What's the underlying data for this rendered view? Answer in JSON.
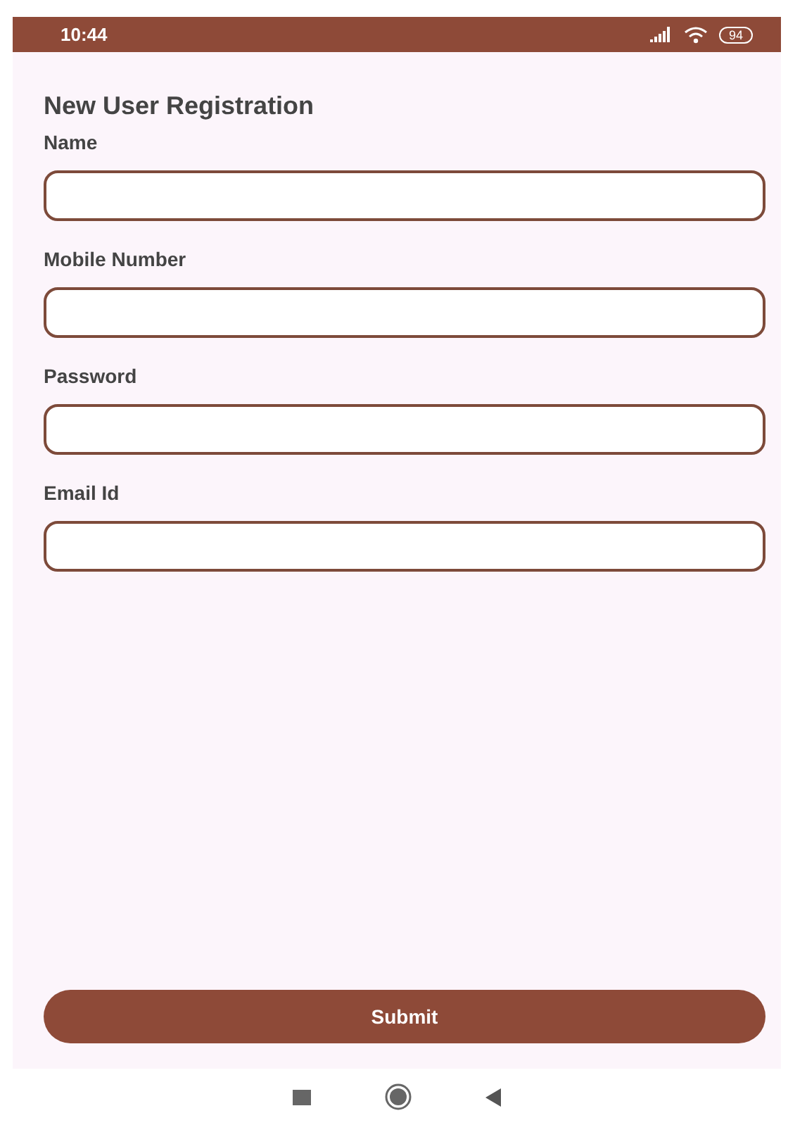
{
  "status_bar": {
    "time": "10:44",
    "battery": "94"
  },
  "title": "New User Registration",
  "fields": [
    {
      "label": "Name"
    },
    {
      "label": "Mobile Number"
    },
    {
      "label": "Password"
    },
    {
      "label": "Email Id"
    }
  ],
  "submit": "Submit"
}
